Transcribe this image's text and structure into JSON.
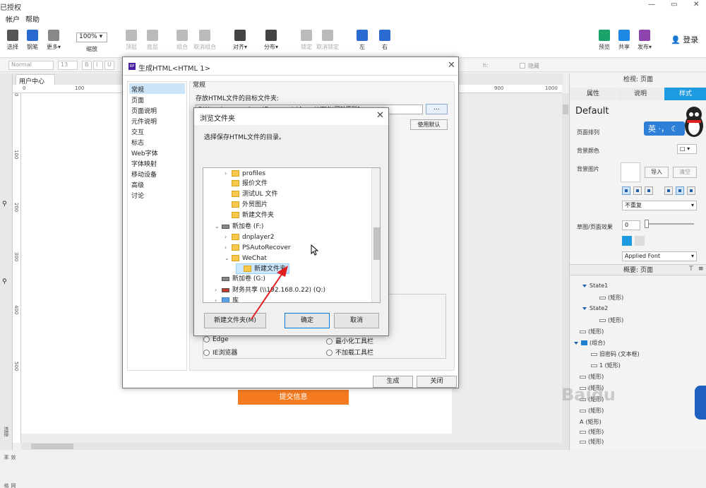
{
  "titlebar": {
    "title": "已授权",
    "min": "—",
    "max": "▭",
    "close": "✕"
  },
  "menubar": {
    "items": [
      "帐户",
      "帮助"
    ]
  },
  "toolbar": {
    "items": [
      {
        "label": "选择",
        "color": "#555555"
      },
      {
        "label": "钢笔",
        "color": "#2b6ad1"
      },
      {
        "label": "更多▾",
        "color": "#888888"
      },
      {
        "label": "缩放",
        "color": "#ffffff"
      },
      {
        "label": "顶层",
        "color": "#bbbbbb"
      },
      {
        "label": "底层",
        "color": "#bbbbbb"
      },
      {
        "label": "组合",
        "color": "#bbbbbb"
      },
      {
        "label": "取消组合",
        "color": "#bbbbbb"
      },
      {
        "label": "对齐▾",
        "color": "#444444"
      },
      {
        "label": "分布▾",
        "color": "#444444"
      },
      {
        "label": "锁定",
        "color": "#bbbbbb"
      },
      {
        "label": "取消锁定",
        "color": "#bbbbbb"
      },
      {
        "label": "左",
        "color": "#2b6ad1"
      },
      {
        "label": "右",
        "color": "#2b6ad1"
      },
      {
        "label": "预览",
        "color": "#1aa26b"
      },
      {
        "label": "共享",
        "color": "#1e88e5"
      },
      {
        "label": "发布▾",
        "color": "#8e44ad"
      }
    ],
    "zoom": "100%",
    "login": "登录"
  },
  "fmtbar": {
    "style": "Normal",
    "size": "13",
    "bold": "B",
    "italic": "I",
    "underline": "U",
    "h_label": "h:",
    "hide": "隐藏"
  },
  "canvas": {
    "tab": "用户中心",
    "tab_close": "✕",
    "hruler": [
      "0",
      "100",
      "900",
      "1000"
    ],
    "vruler": [
      "0",
      "100",
      "200",
      "300",
      "400",
      "500"
    ],
    "submit": "提交信息"
  },
  "leftstrip": [
    "连接",
    "效率",
    "网格"
  ],
  "rpanel": {
    "title": "检视: 页面",
    "tabs": [
      "属性",
      "说明",
      "样式"
    ],
    "default_style": "Default",
    "layout_label": "页面排列",
    "bg_color_label": "背景颜色",
    "bg_image_label": "背景图片",
    "import_btn": "导入",
    "clear_btn": "清空",
    "repeat": "不重复",
    "sketch_label": "草图/页面效果",
    "sketch_value": "0",
    "font": "Applied Font",
    "outline_title": "概要: 页面",
    "outline": [
      "State1",
      "(矩形)",
      "State2",
      "(矩形)",
      "(矩形)",
      "(组合)",
      "旧密码 (文本框)",
      "1 (矩形)",
      "(矩形)",
      "(矩形)",
      "(矩形)",
      "(矩形)",
      "(矩形)",
      "(矩形)",
      "(矩形)"
    ]
  },
  "generate_dialog": {
    "title": "生成HTML<HTML 1>",
    "close": "✕",
    "nav": [
      "常规",
      "页面",
      "页面说明",
      "元件说明",
      "交互",
      "标志",
      "Web字体",
      "字体映射",
      "移动设备",
      "高级",
      "讨论"
    ],
    "section": "常规",
    "target_label": "存放HTML文件的目标文件夹:",
    "path": "C:\\Users\\seacamels_cn\\Documents\\Axure\\HTML\\网站原型1",
    "browse": "...",
    "use_default": "使用默认",
    "radios": [
      "Edge",
      "IE浏览器",
      "最小化工具栏",
      "不加载工具栏"
    ],
    "generate": "生成",
    "close_btn": "关闭"
  },
  "browse_dialog": {
    "title": "浏览文件夹",
    "close": "✕",
    "prompt": "选择保存HTML文件的目录。",
    "tree": [
      {
        "label": "profiles",
        "type": "folder",
        "chevron": "›"
      },
      {
        "label": "报价文件",
        "type": "folder",
        "chevron": ""
      },
      {
        "label": "测试UL 文件",
        "type": "folder",
        "chevron": ""
      },
      {
        "label": "外贸图片",
        "type": "folder",
        "chevron": ""
      },
      {
        "label": "新建文件夹",
        "type": "folder",
        "chevron": ""
      },
      {
        "label": "新加卷 (F:)",
        "type": "drive",
        "chevron": "⌄"
      },
      {
        "label": "dnplayer2",
        "type": "folder",
        "chevron": "›"
      },
      {
        "label": "PSAutoRecover",
        "type": "folder",
        "chevron": "›"
      },
      {
        "label": "WeChat",
        "type": "folder",
        "chevron": "⌄"
      },
      {
        "label": "新建文件夹",
        "type": "folder",
        "chevron": ""
      },
      {
        "label": "新加卷 (G:)",
        "type": "drive",
        "chevron": ""
      },
      {
        "label": "财务共享 (\\\\192.168.0.22) (Q:)",
        "type": "drive",
        "chevron": "›"
      },
      {
        "label": "库",
        "type": "folder",
        "chevron": "›"
      }
    ],
    "new_folder": "新建文件夹(M)",
    "ok": "确定",
    "cancel": "取消"
  },
  "mascot": {
    "badge": "英 ·， ☾"
  },
  "watermark": "Baidu"
}
